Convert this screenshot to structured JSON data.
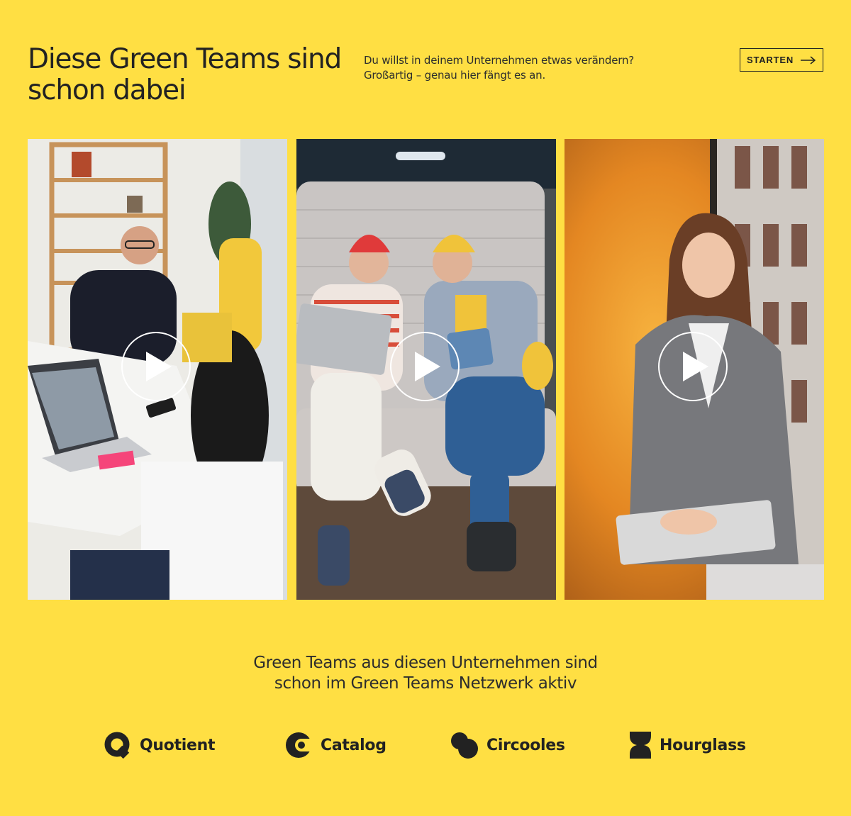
{
  "header": {
    "title_line1": "Diese Green Teams sind",
    "title_line2": "schon dabei",
    "intro_line1": "Du willst in deinem Unternehmen etwas verändern?",
    "intro_line2": "Großartig – genau hier fängt es an.",
    "cta_label": "STARTEN"
  },
  "videos": [
    {
      "scene": "office-meeting-man-smiling",
      "play_icon": "play-icon"
    },
    {
      "scene": "two-people-on-sofa-with-laptop",
      "play_icon": "play-icon"
    },
    {
      "scene": "woman-in-blazer-at-window",
      "play_icon": "play-icon"
    }
  ],
  "network": {
    "line1": "Green Teams aus diesen Unternehmen sind",
    "line2": "schon im Green Teams Netzwerk aktiv"
  },
  "partners": [
    {
      "name": "Quotient",
      "icon": "quotient-logo-icon"
    },
    {
      "name": "Catalog",
      "icon": "catalog-logo-icon"
    },
    {
      "name": "Circooles",
      "icon": "circooles-logo-icon"
    },
    {
      "name": "Hourglass",
      "icon": "hourglass-logo-icon"
    }
  ],
  "colors": {
    "background": "#FFDF43",
    "text": "#222222",
    "play_button": "#FFFFFF"
  }
}
